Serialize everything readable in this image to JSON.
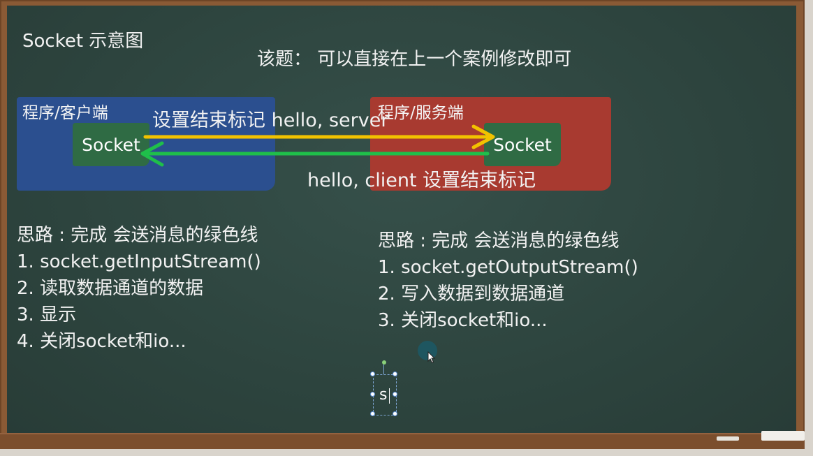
{
  "slide": {
    "title": "Socket 示意图",
    "note": "该题：  可以直接在上一个案例修改即可"
  },
  "diagram": {
    "client": {
      "label": "程序/客户端",
      "socket": "Socket",
      "color": "#2b4f8f"
    },
    "server": {
      "label": "程序/服务端",
      "socket": "Socket",
      "color": "#a83a30"
    },
    "message_to_server": "设置结束标记 hello, server",
    "message_to_client": "hello, client 设置结束标记",
    "arrow_colors": {
      "to_server": "#f2c200",
      "to_client": "#1fbf4a"
    }
  },
  "left_steps": [
    "思路 : 完成 会送消息的绿色线",
    "1. socket.getInputStream()",
    "2. 读取数据通道的数据",
    "3. 显示",
    "4. 关闭socket和io..."
  ],
  "right_steps": [
    "思路 : 完成 会送消息的绿色线",
    "1. socket.getOutputStream()",
    "2. 写入数据到数据通道",
    "3. 关闭socket和io..."
  ],
  "edit_box": {
    "text": "s"
  }
}
